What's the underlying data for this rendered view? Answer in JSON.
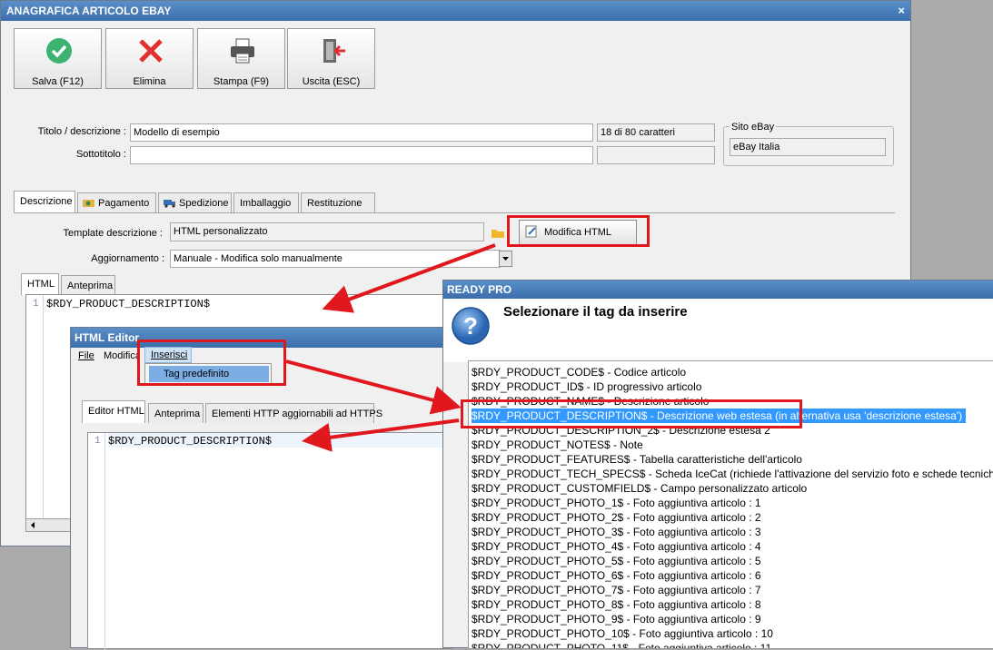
{
  "main_window": {
    "title": "ANAGRAFICA ARTICOLO EBAY",
    "close_glyph": "×",
    "toolbar": [
      {
        "label": "Salva (F12)",
        "icon": "check-icon"
      },
      {
        "label": "Elimina",
        "icon": "delete-icon"
      },
      {
        "label": "Stampa (F9)",
        "icon": "printer-icon"
      },
      {
        "label": "Uscita (ESC)",
        "icon": "exit-icon"
      }
    ],
    "title_label": "Titolo / descrizione :",
    "title_value": "Modello di esempio",
    "char_count": "18 di 80 caratteri",
    "subtitle_label": "Sottotitolo :",
    "subtitle_value": "",
    "ebay_site_group": "Sito eBay",
    "ebay_site_value": "eBay Italia",
    "tabs": [
      "Descrizione",
      "Pagamento",
      "Spedizione",
      "Imballaggio",
      "Restituzione"
    ],
    "template_label": "Template descrizione :",
    "template_value": "HTML personalizzato",
    "edit_html_button": "Modifica HTML",
    "update_label": "Aggiornamento :",
    "update_value": "Manuale - Modifica solo manualmente",
    "subtabs": [
      "HTML",
      "Anteprima"
    ],
    "editor_line_number": "1",
    "editor_content": "$RDY_PRODUCT_DESCRIPTION$"
  },
  "html_editor": {
    "title": "HTML Editor",
    "menu": [
      "File",
      "Modifica",
      "Inserisci"
    ],
    "dropdown_item": "Tag predefinito",
    "tabs": [
      "Editor HTML",
      "Anteprima",
      "Elementi HTTP aggiornabili ad HTTPS"
    ],
    "line_number": "1",
    "content": "$RDY_PRODUCT_DESCRIPTION$"
  },
  "ready_pro": {
    "title": "READY PRO",
    "prompt": "Selezionare il tag da inserire",
    "items": [
      "$RDY_PRODUCT_CODE$ - Codice articolo",
      "$RDY_PRODUCT_ID$ - ID progressivo articolo",
      "$RDY_PRODUCT_NAME$ - Descrizione articolo",
      "$RDY_PRODUCT_DESCRIPTION$ - Descrizione web estesa (in alternativa usa 'descrizione estesa')",
      "$RDY_PRODUCT_DESCRIPTION_2$ - Descrizione estesa 2",
      "$RDY_PRODUCT_NOTES$ - Note",
      "$RDY_PRODUCT_FEATURES$ - Tabella caratteristiche dell'articolo",
      "$RDY_PRODUCT_TECH_SPECS$ - Scheda IceCat (richiede l'attivazione del servizio foto e schede tecniche)",
      "$RDY_PRODUCT_CUSTOMFIELD$ - Campo personalizzato articolo",
      "$RDY_PRODUCT_PHOTO_1$ - Foto aggiuntiva articolo : 1",
      "$RDY_PRODUCT_PHOTO_2$ - Foto aggiuntiva articolo : 2",
      "$RDY_PRODUCT_PHOTO_3$ - Foto aggiuntiva articolo : 3",
      "$RDY_PRODUCT_PHOTO_4$ - Foto aggiuntiva articolo : 4",
      "$RDY_PRODUCT_PHOTO_5$ - Foto aggiuntiva articolo : 5",
      "$RDY_PRODUCT_PHOTO_6$ - Foto aggiuntiva articolo : 6",
      "$RDY_PRODUCT_PHOTO_7$ - Foto aggiuntiva articolo : 7",
      "$RDY_PRODUCT_PHOTO_8$ - Foto aggiuntiva articolo : 8",
      "$RDY_PRODUCT_PHOTO_9$ - Foto aggiuntiva articolo : 9",
      "$RDY_PRODUCT_PHOTO_10$ - Foto aggiuntiva articolo : 10",
      "$RDY_PRODUCT_PHOTO_11$ - Foto aggiuntiva articolo : 11"
    ],
    "selected_index": 3
  },
  "colors": {
    "titlebar": "#3b6eab",
    "annotation_red": "#e0181e",
    "selection": "#3399ff"
  }
}
